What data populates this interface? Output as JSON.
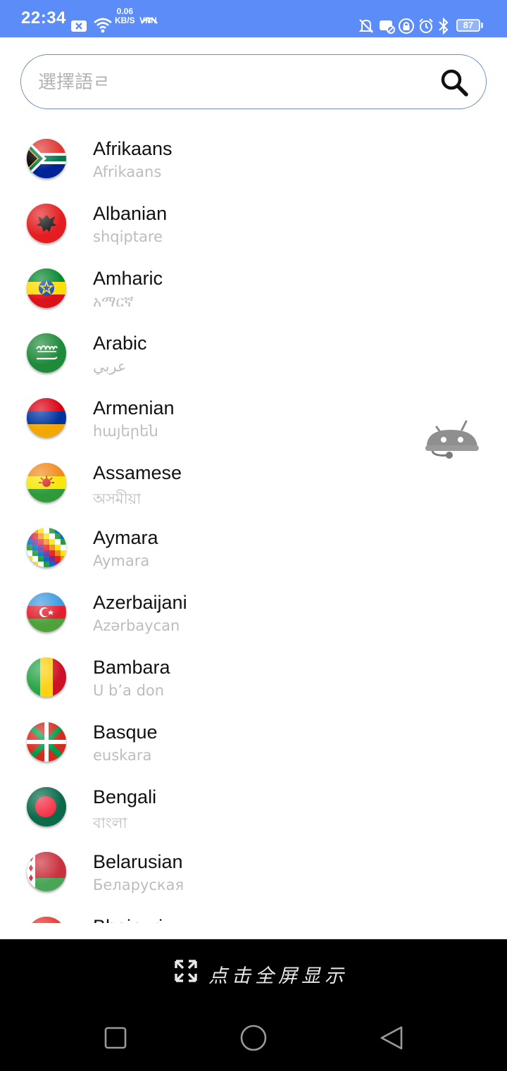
{
  "status_bar": {
    "time": "22:34",
    "net_speed_value": "0.06",
    "net_speed_unit": "KB/S",
    "vpn": "VPN",
    "battery": "87",
    "icons": [
      "close-box-icon",
      "wifi-icon",
      "vpn-icon",
      "mute-bell-icon",
      "notification-off-icon",
      "lock-icon",
      "alarm-icon",
      "bluetooth-icon",
      "battery-icon"
    ]
  },
  "search": {
    "placeholder": "選擇語ㄹ",
    "icon": "search-icon"
  },
  "languages": [
    {
      "name": "Afrikaans",
      "native": "Afrikaans",
      "flag": "south-africa-flag-icon"
    },
    {
      "name": "Albanian",
      "native": "shqiptare",
      "flag": "albania-flag-icon"
    },
    {
      "name": "Amharic",
      "native": "አማርኛ",
      "flag": "ethiopia-flag-icon"
    },
    {
      "name": "Arabic",
      "native": "عربي",
      "flag": "saudi-arabia-flag-icon"
    },
    {
      "name": "Armenian",
      "native": "հայերեն",
      "flag": "armenia-flag-icon"
    },
    {
      "name": "Assamese",
      "native": "অসমীয়া",
      "flag": "assam-flag-icon"
    },
    {
      "name": "Aymara",
      "native": "Aymara",
      "flag": "wiphala-flag-icon"
    },
    {
      "name": "Azerbaijani",
      "native": "Azərbaycan",
      "flag": "azerbaijan-flag-icon"
    },
    {
      "name": "Bambara",
      "native": "U b’a don",
      "flag": "mali-flag-icon"
    },
    {
      "name": "Basque",
      "native": "euskara",
      "flag": "basque-flag-icon"
    },
    {
      "name": "Bengali",
      "native": "বাংলা",
      "flag": "bangladesh-flag-icon"
    },
    {
      "name": "Belarusian",
      "native": "Беларуская",
      "flag": "belarus-flag-icon"
    },
    {
      "name": "Bhojpuri",
      "native": "",
      "flag": "india-flag-icon"
    }
  ],
  "floating": {
    "icon": "robot-assistant-icon"
  },
  "bottom_bar": {
    "fullscreen_label": "点击全屏显示",
    "fullscreen_icon": "expand-arrows-icon",
    "nav": [
      "recent-apps-icon",
      "home-icon",
      "back-icon"
    ]
  },
  "colors": {
    "status_bar": "#5b8cf7",
    "search_border": "#6d8fb8",
    "subtitle_text": "#bdbdbd",
    "bottom_bar": "#000000"
  }
}
